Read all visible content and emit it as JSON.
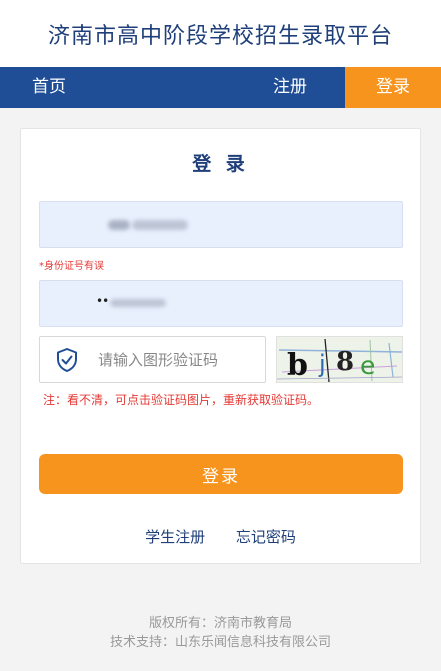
{
  "header": {
    "title": "济南市高中阶段学校招生录取平台"
  },
  "nav": {
    "home": "首页",
    "register": "注册",
    "login": "登录"
  },
  "form": {
    "title": "登 录",
    "id_error": "*身份证号有误",
    "password_value": "••",
    "captcha_placeholder": "请输入图形验证码",
    "captcha_text": "bj8e",
    "note": "注：看不清，可点击验证码图片，重新获取验证码。",
    "login_button": "登录",
    "student_register": "学生注册",
    "forgot_password": "忘记密码"
  },
  "footer": {
    "copyright": "版权所有：济南市教育局",
    "support": "技术支持：山东乐闻信息科技有限公司"
  },
  "colors": {
    "brand_blue": "#1f4e96",
    "accent_orange": "#f7941d",
    "error_red": "#e53935"
  }
}
